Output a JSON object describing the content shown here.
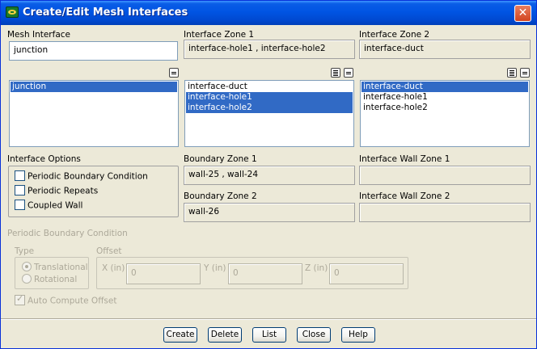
{
  "window": {
    "title": "Create/Edit Mesh Interfaces",
    "close_glyph": "✕"
  },
  "mesh_interface": {
    "label": "Mesh Interface",
    "value": "junction",
    "items": [
      {
        "label": "junction",
        "selected": true
      }
    ]
  },
  "zone1": {
    "label": "Interface Zone 1",
    "value": "interface-hole1 , interface-hole2",
    "items": [
      {
        "label": "interface-duct",
        "selected": false
      },
      {
        "label": "interface-hole1",
        "selected": true
      },
      {
        "label": "interface-hole2",
        "selected": true
      }
    ]
  },
  "zone2": {
    "label": "Interface Zone 2",
    "value": "interface-duct",
    "items": [
      {
        "label": "interface-duct",
        "selected": true
      },
      {
        "label": "interface-hole1",
        "selected": false
      },
      {
        "label": "interface-hole2",
        "selected": false
      }
    ]
  },
  "options": {
    "label": "Interface Options",
    "periodic_bc": "Periodic Boundary Condition",
    "periodic_repeats": "Periodic Repeats",
    "coupled_wall": "Coupled Wall"
  },
  "boundary1": {
    "label": "Boundary Zone 1",
    "value": "wall-25 , wall-24"
  },
  "boundary2": {
    "label": "Boundary Zone 2",
    "value": "wall-26"
  },
  "wall1": {
    "label": "Interface Wall Zone 1",
    "value": ""
  },
  "wall2": {
    "label": "Interface Wall Zone 2",
    "value": ""
  },
  "periodic": {
    "label": "Periodic Boundary Condition",
    "type_label": "Type",
    "translational": "Translational",
    "rotational": "Rotational",
    "offset_label": "Offset",
    "x_label": "X (in)",
    "x_value": "0",
    "y_label": "Y (in)",
    "y_value": "0",
    "z_label": "Z (in)",
    "z_value": "0",
    "auto_compute": "Auto Compute Offset"
  },
  "buttons": {
    "create": "Create",
    "delete": "Delete",
    "list": "List",
    "close": "Close",
    "help": "Help"
  },
  "colors": {
    "selection": "#316ac5",
    "title_bar": "#0054e3",
    "dialog_bg": "#ece9d8"
  }
}
